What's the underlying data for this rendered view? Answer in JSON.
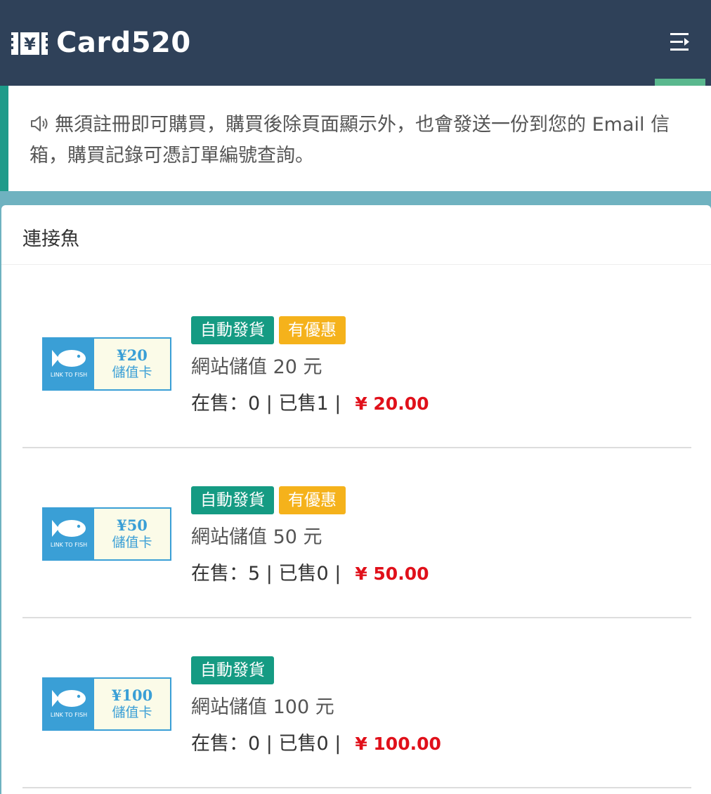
{
  "header": {
    "logo_text": "Card520",
    "logo_icon": "ticket-yen-icon",
    "menu_icon": "menu-collapse-icon",
    "colors": {
      "bar": "#2f4159",
      "accent": "#5ab88e"
    }
  },
  "notice": {
    "icon": "speaker-icon",
    "text": "無須註冊即可購買，購買後除頁面顯示外，也會發送一份到您的 Email 信箱，購買記錄可憑訂單編號查詢。"
  },
  "category": {
    "title": "連接魚"
  },
  "products": [
    {
      "thumb_amount": "¥20",
      "thumb_label": "儲值卡",
      "thumb_brand": "LINK TO FISH",
      "tags": [
        "自動發貨",
        "有優惠"
      ],
      "title": "網站儲值 20 元",
      "stock": "在售：0 | 已售1 |",
      "price": "¥ 20.00"
    },
    {
      "thumb_amount": "¥50",
      "thumb_label": "儲值卡",
      "thumb_brand": "LINK TO FISH",
      "tags": [
        "自動發貨",
        "有優惠"
      ],
      "title": "網站儲值 50 元",
      "stock": "在售：5 | 已售0 |",
      "price": "¥ 50.00"
    },
    {
      "thumb_amount": "¥100",
      "thumb_label": "儲值卡",
      "thumb_brand": "LINK TO FISH",
      "tags": [
        "自動發貨"
      ],
      "title": "網站儲值 100 元",
      "stock": "在售：0 | 已售0 |",
      "price": "¥ 100.00"
    }
  ],
  "colors": {
    "tag_auto": "#159b83",
    "tag_promo": "#f5b21b",
    "price": "#e0101a",
    "thumb": "#3a9fd6"
  }
}
